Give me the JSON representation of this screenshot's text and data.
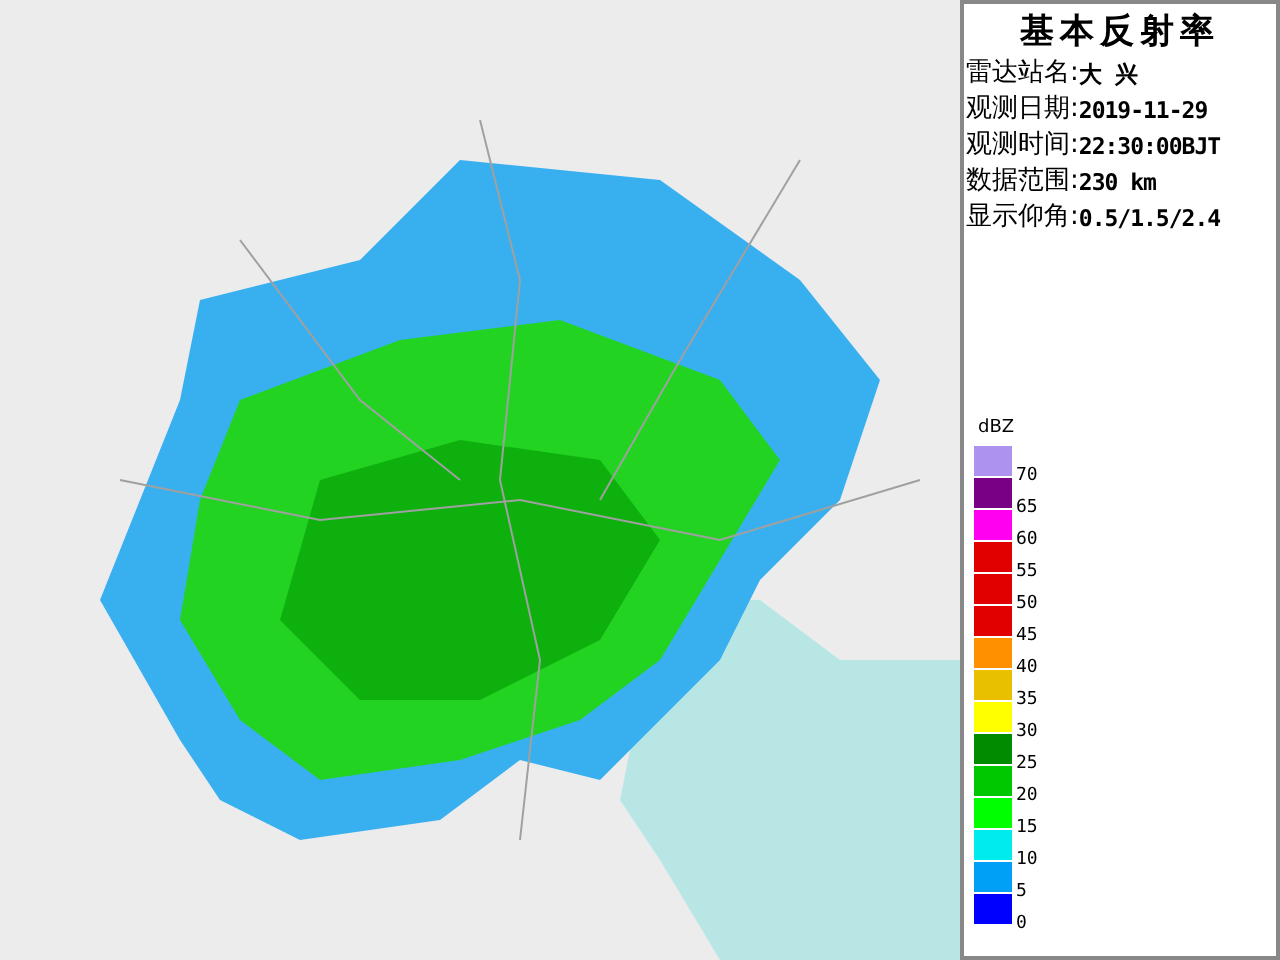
{
  "title": "基本反射率",
  "info": [
    {
      "label": "雷达站名:",
      "value": "大 兴"
    },
    {
      "label": "观测日期:",
      "value": "2019-11-29"
    },
    {
      "label": "观测时间:",
      "value": "22:30:00BJT"
    },
    {
      "label": "数据范围:",
      "value": "230 km"
    },
    {
      "label": "显示仰角:",
      "value": "0.5/1.5/2.4"
    }
  ],
  "legend": {
    "unit": "dBZ",
    "items": [
      {
        "label": "70",
        "color": "#ad92ef"
      },
      {
        "label": "65",
        "color": "#780084"
      },
      {
        "label": "60",
        "color": "#ff00f0"
      },
      {
        "label": "55",
        "color": "#e00000"
      },
      {
        "label": "50",
        "color": "#e00000"
      },
      {
        "label": "45",
        "color": "#e00000"
      },
      {
        "label": "40",
        "color": "#ff9000"
      },
      {
        "label": "35",
        "color": "#e8c000"
      },
      {
        "label": "30",
        "color": "#ffff00"
      },
      {
        "label": "25",
        "color": "#008c00"
      },
      {
        "label": "20",
        "color": "#00c800"
      },
      {
        "label": "15",
        "color": "#00ff00"
      },
      {
        "label": "10",
        "color": "#00ecec"
      },
      {
        "label": "5",
        "color": "#00a0f6"
      },
      {
        "label": "0",
        "color": "#0000ff"
      }
    ]
  }
}
